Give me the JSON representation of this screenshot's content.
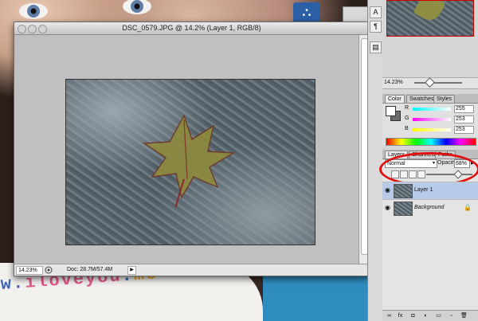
{
  "document": {
    "title": "DSC_0579.JPG @ 14.2% (Layer 1, RGB/8)",
    "zoom": "14.23%",
    "doc_size": "Doc: 28.7M/57.4M",
    "status_arrow_icon": "triangle-right-icon"
  },
  "background": {
    "bib_text": [
      "w.",
      "iloveyou",
      ".",
      "me"
    ]
  },
  "tool_strip": {
    "buttons": [
      {
        "name": "character-icon",
        "glyph": "A"
      },
      {
        "name": "paragraph-icon",
        "glyph": "¶"
      },
      {
        "name": "panel-icon",
        "glyph": "▤"
      }
    ]
  },
  "navigator": {
    "zoom": "14.23%"
  },
  "color_panel": {
    "tabs": [
      "Color",
      "Swatches",
      "Styles"
    ],
    "rows": [
      {
        "label": "R",
        "value": "255"
      },
      {
        "label": "G",
        "value": "253"
      },
      {
        "label": "B",
        "value": "253"
      }
    ],
    "colors": {
      "r_bar": "#00c8e0",
      "g_bar": "#e020e0",
      "b_bar": "#e8e800"
    }
  },
  "layers_panel": {
    "tabs": [
      "Layers",
      "Channels",
      "Paths"
    ],
    "blend_mode": "Normal",
    "opacity_label": "Opacity:",
    "opacity_value": "68%",
    "layers": [
      {
        "name": "Layer 1",
        "selected": true
      },
      {
        "name": "Background",
        "selected": false,
        "locked": true
      }
    ],
    "footer_icons": [
      "link-icon",
      "fx-icon",
      "mask-icon",
      "adjustment-icon",
      "folder-icon",
      "new-layer-icon",
      "trash-icon"
    ],
    "footer_glyphs": [
      "∞",
      "fx",
      "◘",
      "◐",
      "▭",
      "▫",
      "🗑"
    ]
  },
  "accent": {
    "highlight": "#e01010",
    "selection": "#b7cbe9"
  }
}
